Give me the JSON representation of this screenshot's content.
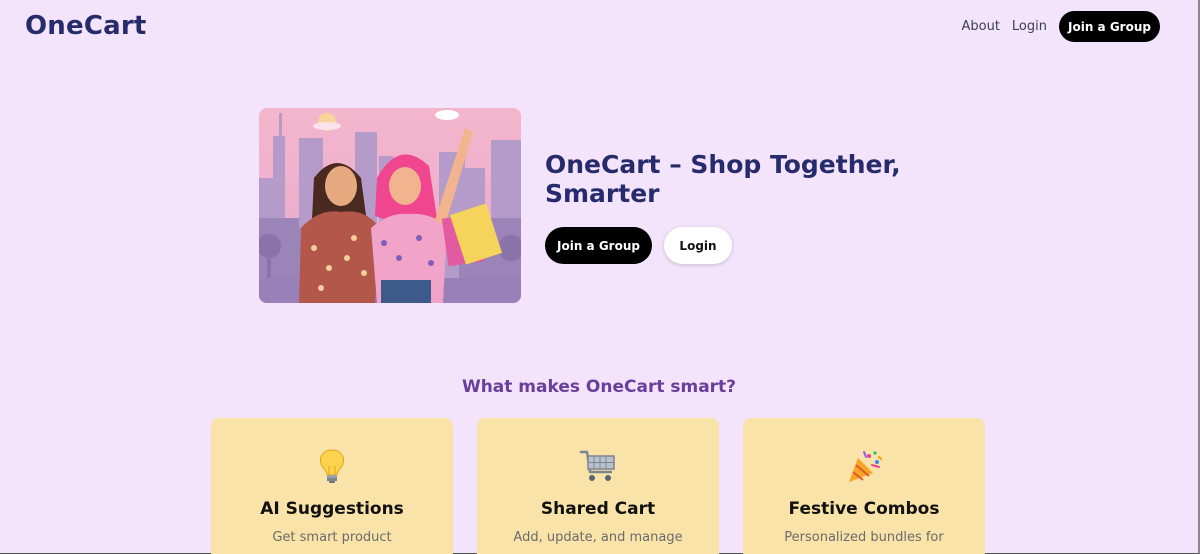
{
  "header": {
    "logo": "OneCart",
    "nav": {
      "about": "About",
      "login": "Login",
      "join": "Join a Group"
    }
  },
  "hero": {
    "title": "OneCart – Shop Together, Smarter",
    "primary_button": "Join a Group",
    "secondary_button": "Login"
  },
  "features": {
    "heading": "What makes OneCart smart?",
    "cards": [
      {
        "icon": "lightbulb-icon",
        "title": "AI Suggestions",
        "text": "Get smart product"
      },
      {
        "icon": "shopping-cart-icon",
        "title": "Shared Cart",
        "text": "Add, update, and manage"
      },
      {
        "icon": "party-popper-icon",
        "title": "Festive Combos",
        "text": "Personalized bundles for"
      }
    ]
  },
  "colors": {
    "background": "#f3e3fb",
    "brand": "#262c6b",
    "accent": "#6a3f9c",
    "card": "#f9e3a8"
  }
}
